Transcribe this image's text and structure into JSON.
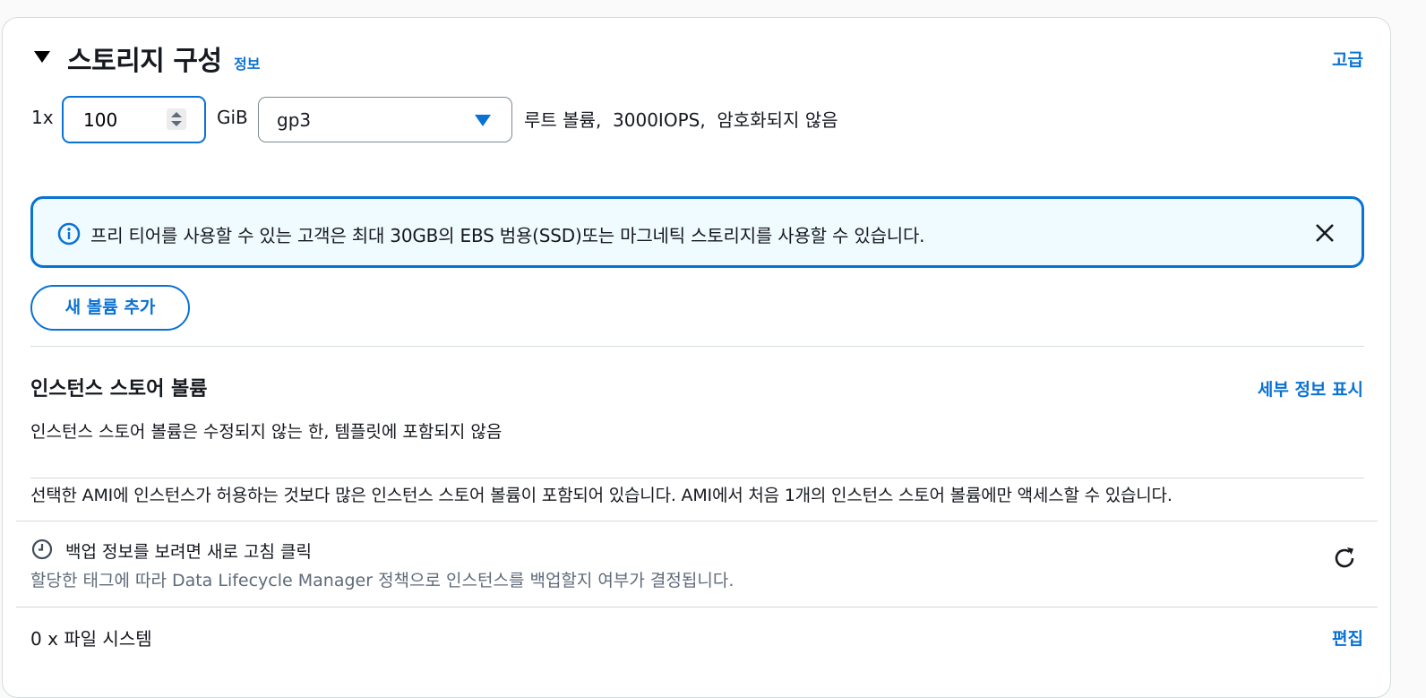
{
  "storage": {
    "title": "스토리지 구성",
    "info_link": "정보",
    "advanced_link": "고급",
    "volume_count": "1x",
    "size_value": "100",
    "size_unit": "GiB",
    "volume_type": "gp3",
    "volume_description": "루트 볼륨,  3000IOPS,  암호화되지 않음",
    "alert_text": "프리 티어를 사용할 수 있는 고객은 최대 30GB의 EBS 범용(SSD)또는 마그네틱 스토리지를 사용할 수 있습니다.",
    "add_volume_button": "새 볼륨 추가"
  },
  "instance_store": {
    "title": "인스턴스 스토어 볼륨",
    "details_link": "세부 정보 표시",
    "description": "인스턴스 스토어 볼륨은 수정되지 않는 한, 템플릿에 포함되지 않음",
    "ami_note": "선택한 AMI에 인스턴스가 허용하는 것보다 많은 인스턴스 스토어 볼륨이 포함되어 있습니다. AMI에서 처음 1개의 인스턴스 스토어 볼륨에만 액세스할 수 있습니다."
  },
  "backup": {
    "title": "백업 정보를 보려면 새로 고침 클릭",
    "description": "할당한 태그에 따라 Data Lifecycle Manager 정책으로 인스턴스를 백업할지 여부가 결정됩니다."
  },
  "file_systems": {
    "label": "0 x 파일 시스템",
    "edit_link": "편집"
  },
  "icons": {
    "caret": "caret-down-icon",
    "spinner": "spinner-icon",
    "dropdown": "dropdown-arrow-icon",
    "info": "info-circle-icon",
    "close": "close-icon",
    "clock": "clock-icon",
    "refresh": "refresh-icon"
  },
  "colors": {
    "accent": "#0972d3",
    "alert_background": "#f0fbff",
    "border": "#d5dbdb",
    "secondary_text": "#5f6b7a"
  }
}
